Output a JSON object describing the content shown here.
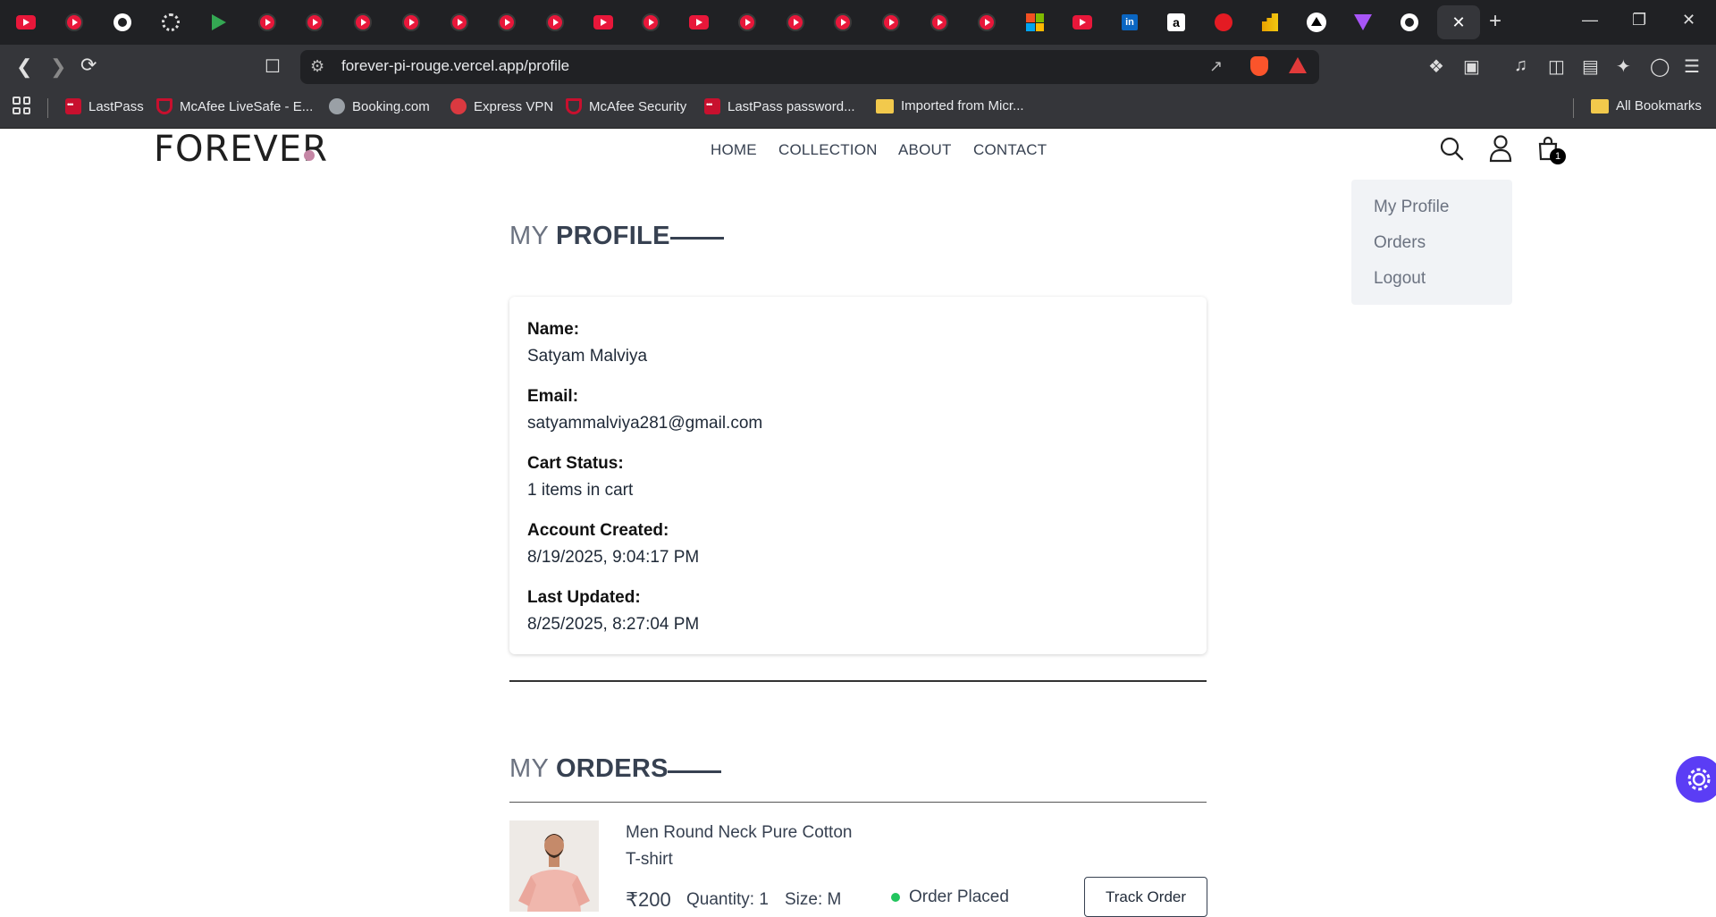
{
  "browser": {
    "url": "forever-pi-rouge.vercel.app/profile",
    "bookmarks": [
      "LastPass",
      "McAfee LiveSafe - E...",
      "Booking.com",
      "Express VPN",
      "McAfee Security",
      "LastPass password...",
      "Imported from Micr...",
      "All Bookmarks"
    ],
    "close_glyph": "✕",
    "new_tab_glyph": "+"
  },
  "header": {
    "logo": "FOREVER",
    "nav": [
      "HOME",
      "COLLECTION",
      "ABOUT",
      "CONTACT"
    ],
    "cart_count": "1",
    "accent": "#c586a5"
  },
  "dropdown": {
    "items": [
      "My Profile",
      "Orders",
      "Logout"
    ]
  },
  "profile": {
    "title_light": "MY",
    "title_bold": "PROFILE",
    "fields": [
      {
        "label": "Name:",
        "value": "Satyam Malviya"
      },
      {
        "label": "Email:",
        "value": "satyammalviya281@gmail.com"
      },
      {
        "label": "Cart Status:",
        "value": "1 items in cart"
      },
      {
        "label": "Account Created:",
        "value": "8/19/2025, 9:04:17 PM"
      },
      {
        "label": "Last Updated:",
        "value": "8/25/2025, 8:27:04 PM"
      }
    ]
  },
  "orders": {
    "title_light": "MY",
    "title_bold": "ORDERS",
    "items": [
      {
        "name_line1": "Men Round Neck Pure Cotton",
        "name_line2": "T-shirt",
        "price": "₹200",
        "quantity": "Quantity: 1",
        "size": "Size: M",
        "status": "Order Placed",
        "status_color": "#22c55e",
        "action": "Track Order"
      }
    ]
  }
}
